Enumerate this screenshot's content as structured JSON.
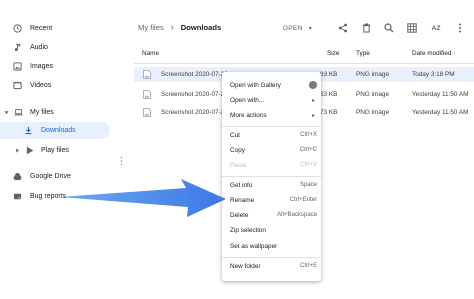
{
  "sidebar": {
    "recent": "Recent",
    "audio": "Audio",
    "images": "Images",
    "videos": "Videos",
    "my_files": "My files",
    "downloads": "Downloads",
    "play_files": "Play files",
    "google_drive": "Google Drive",
    "bug_reports": "Bug reports"
  },
  "breadcrumb": {
    "root": "My files",
    "separator": "›",
    "current": "Downloads"
  },
  "toolbar": {
    "open_label": "OPEN",
    "sort_label": "AZ"
  },
  "columns": {
    "name": "Name",
    "size": "Size",
    "type": "Type",
    "date": "Date modified"
  },
  "files": [
    {
      "name": "Screenshot 2020-07-26",
      "size": "83 KB",
      "type": "PNG image",
      "date": "Today 3:18 PM",
      "selected": true
    },
    {
      "name": "Screenshot 2020-07-25",
      "size": "63 KB",
      "type": "PNG image",
      "date": "Yesterday 11:50 AM",
      "selected": false
    },
    {
      "name": "Screenshot 2020-07-25",
      "size": "73 KB",
      "type": "PNG image",
      "date": "Yesterday 11:50 AM",
      "selected": false
    }
  ],
  "context_menu": {
    "open_with_gallery": "Open with Gallery",
    "open_with": "Open with...",
    "more_actions": "More actions",
    "cut": {
      "label": "Cut",
      "shortcut": "Ctrl+X"
    },
    "copy": {
      "label": "Copy",
      "shortcut": "Ctrl+C"
    },
    "paste": {
      "label": "Paste",
      "shortcut": "Ctrl+V"
    },
    "get_info": {
      "label": "Get info",
      "shortcut": "Space"
    },
    "rename": {
      "label": "Rename",
      "shortcut": "Ctrl+Enter"
    },
    "delete": {
      "label": "Delete",
      "shortcut": "Alt+Backspace"
    },
    "zip_selection": "Zip selection",
    "set_as_wallpaper": "Set as wallpaper",
    "new_folder": {
      "label": "New folder",
      "shortcut": "Ctrl+E"
    }
  },
  "colors": {
    "accent": "#1a73e8",
    "selected_bg": "#e8f0fe",
    "annotation_arrow": "#4a86e8"
  }
}
